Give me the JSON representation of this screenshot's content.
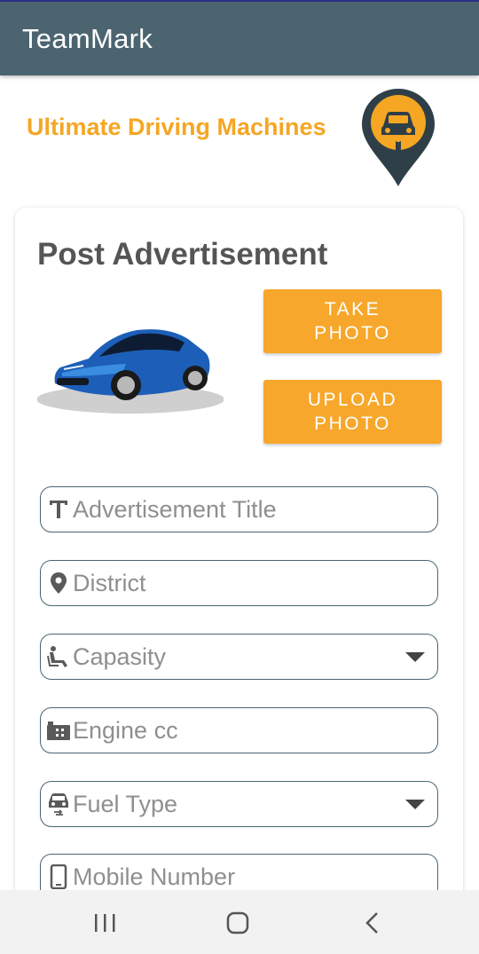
{
  "app": {
    "title": "TeamMark"
  },
  "brand": {
    "tagline": "Ultimate Driving Machines",
    "logo_icon": "car-key-pin-icon"
  },
  "form": {
    "title": "Post Advertisement",
    "car_image_icon": "blue-sports-car",
    "take_photo_label": "TAKE PHOTO",
    "upload_photo_label": "UPLOAD PHOTO",
    "fields": {
      "title": {
        "placeholder": "Advertisement Title",
        "icon": "text-icon"
      },
      "district": {
        "placeholder": "District",
        "icon": "location-pin-icon"
      },
      "capacity": {
        "placeholder": "Capasity",
        "icon": "seat-icon"
      },
      "engine": {
        "placeholder": "Engine cc",
        "icon": "engine-icon"
      },
      "fuel": {
        "placeholder": "Fuel Type",
        "icon": "car-icon"
      },
      "mobile": {
        "placeholder": "Mobile Number",
        "icon": "phone-icon"
      }
    }
  },
  "navbar": {
    "recents_icon": "recents-icon",
    "home_icon": "home-icon",
    "back_icon": "back-icon"
  },
  "colors": {
    "appbar": "#4b6470",
    "accent": "#f5a623",
    "button": "#f7a72b",
    "field_border": "#4a6572"
  }
}
